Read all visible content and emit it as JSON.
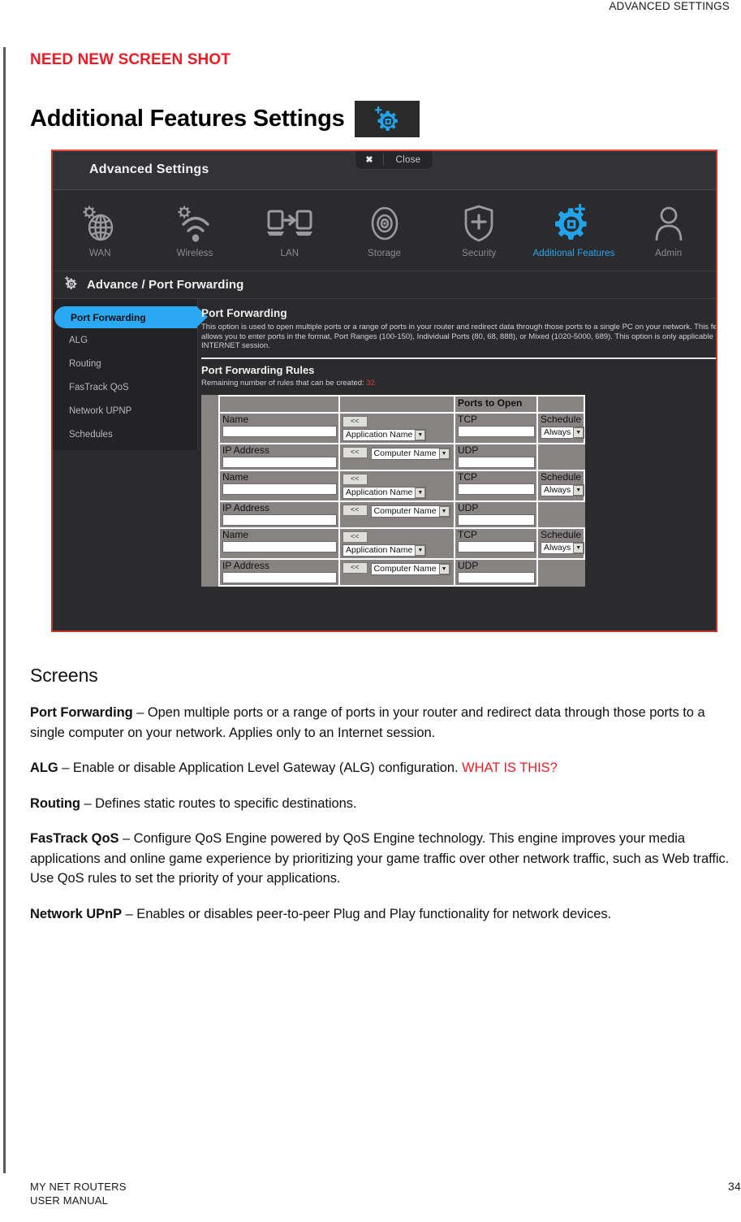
{
  "page_header": {
    "running_head": "ADVANCED SETTINGS"
  },
  "notes": {
    "need_new_screenshot": "NEED NEW SCREEN SHOT"
  },
  "heading": {
    "title": "Additional Features Settings",
    "icon": "gear-plus-icon"
  },
  "screenshot": {
    "window_title": "Advanced Settings",
    "close_button": {
      "label": "Close",
      "icon": "close-x-icon"
    },
    "nav_items": [
      {
        "label": "WAN",
        "icon": "globe-gear-icon",
        "active": false
      },
      {
        "label": "Wireless",
        "icon": "wifi-gear-icon",
        "active": false
      },
      {
        "label": "LAN",
        "icon": "devices-arrow-icon",
        "active": false
      },
      {
        "label": "Storage",
        "icon": "disc-icon",
        "active": false
      },
      {
        "label": "Security",
        "icon": "shield-plus-icon",
        "active": false
      },
      {
        "label": "Additional Features",
        "icon": "gear-plus-icon",
        "active": true
      },
      {
        "label": "Admin",
        "icon": "person-icon",
        "active": false
      }
    ],
    "breadcrumb": "Advance / Port Forwarding",
    "breadcrumb_icon": "gear-plus-small-icon",
    "side_nav": [
      {
        "label": "Port Forwarding",
        "active": true
      },
      {
        "label": "ALG",
        "active": false
      },
      {
        "label": "Routing",
        "active": false
      },
      {
        "label": "FasTrack QoS",
        "active": false
      },
      {
        "label": "Network UPNP",
        "active": false
      },
      {
        "label": "Schedules",
        "active": false
      }
    ],
    "pane": {
      "heading": "Port Forwarding",
      "description": "This option is used to open multiple ports or a range of ports in your router and redirect data through those ports to a single PC on your network. This feature allows you to enter ports in the format, Port Ranges (100-150), Individual Ports (80, 68, 888), or Mixed (1020-5000, 689). This option is only applicable to the INTERNET session.",
      "rules_heading": "Port Forwarding Rules",
      "remaining_label": "Remaining number of rules that can be created:",
      "remaining_value": "32"
    },
    "table": {
      "header_ports": "Ports to Open",
      "rules": [
        {
          "name_label": "Name",
          "name_value": "",
          "app_button": "<<",
          "app_select": "Application Name",
          "tcp_label": "TCP",
          "tcp_value": "",
          "schedule_label": "Schedule",
          "schedule_select": "Always",
          "ip_label": "IP Address",
          "ip_value": "",
          "computer_button": "<<",
          "computer_select": "Computer Name",
          "udp_label": "UDP",
          "udp_value": ""
        },
        {
          "name_label": "Name",
          "name_value": "",
          "app_button": "<<",
          "app_select": "Application Name",
          "tcp_label": "TCP",
          "tcp_value": "",
          "schedule_label": "Schedule",
          "schedule_select": "Always",
          "ip_label": "IP Address",
          "ip_value": "",
          "computer_button": "<<",
          "computer_select": "Computer Name",
          "udp_label": "UDP",
          "udp_value": ""
        },
        {
          "name_label": "Name",
          "name_value": "",
          "app_button": "<<",
          "app_select": "Application Name",
          "tcp_label": "TCP",
          "tcp_value": "",
          "schedule_label": "Schedule",
          "schedule_select": "Always",
          "ip_label": "IP Address",
          "ip_value": "",
          "computer_button": "<<",
          "computer_select": "Computer Name",
          "udp_label": "UDP",
          "udp_value": ""
        }
      ]
    }
  },
  "screens": {
    "heading": "Screens",
    "items": [
      {
        "term": "Port Forwarding",
        "dash": " – ",
        "text": "Open multiple ports or a range of ports in your router and redirect data through those ports to a single computer on your network. Applies only to an Internet session.",
        "red_text": ""
      },
      {
        "term": "ALG",
        "dash": " – ",
        "text": "Enable or disable Application Level Gateway (ALG) configuration. ",
        "red_text": "WHAT IS THIS?"
      },
      {
        "term": "Routing",
        "dash": " – ",
        "text": "Defines static routes to specific destinations.",
        "red_text": ""
      },
      {
        "term": "FasTrack QoS",
        "dash": " – ",
        "text": "Configure QoS Engine powered by QoS Engine technology. This engine improves your media applications and online game experience by prioritizing your game traffic over other network traffic, such as Web traffic. Use QoS rules to set the priority of your applications.",
        "red_text": ""
      },
      {
        "term": "Network UPnP",
        "dash": " – ",
        "text": "Enables or disables peer-to-peer Plug and Play functionality for network devices.",
        "red_text": ""
      }
    ]
  },
  "footer": {
    "line1": "MY NET ROUTERS",
    "line2": "USER MANUAL",
    "page_number": "34"
  },
  "colors": {
    "accent_blue": "#2aa8f2",
    "alert_red": "#ed1c24",
    "shot_border": "#c0392b"
  }
}
